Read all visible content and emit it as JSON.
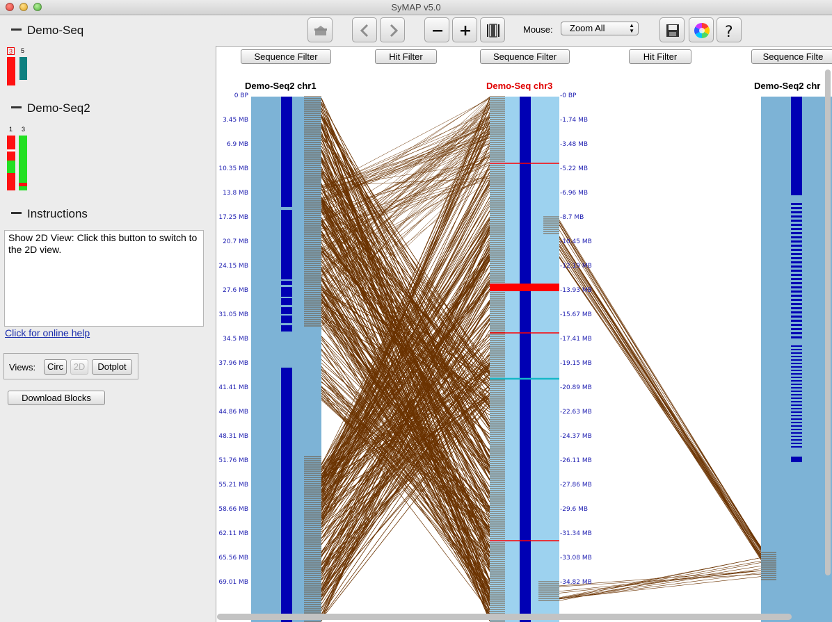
{
  "window": {
    "title": "SyMAP v5.0"
  },
  "sidebar": {
    "sections": [
      {
        "label": "Demo-Seq"
      },
      {
        "label": "Demo-Seq2"
      },
      {
        "label": "Instructions"
      }
    ],
    "demo_seq_chroms": [
      "3",
      "5"
    ],
    "demo_seq2_chroms": [
      "1",
      "3"
    ],
    "instructions_text": "Show 2D View: Click this button to switch to the 2D view.",
    "help_link": "Click for online help",
    "views_label": "Views:",
    "views_buttons": {
      "circ": "Circ",
      "twod": "2D",
      "dotplot": "Dotplot"
    },
    "download_label": "Download Blocks"
  },
  "toolbar": {
    "icons": [
      "home-icon",
      "back-arrow-icon",
      "forward-arrow-icon",
      "zoom-out-icon",
      "zoom-in-icon",
      "fit-icon",
      "save-icon",
      "color-wheel-icon",
      "help-icon"
    ],
    "mouse_label": "Mouse:",
    "mouse_mode": "Zoom All"
  },
  "canvas": {
    "filter_buttons": [
      "Sequence Filter",
      "Hit Filter",
      "Sequence Filter",
      "Hit Filter",
      "Sequence Filte"
    ],
    "tracks": [
      {
        "title": "Demo-Seq2 chr1",
        "color": "#000000"
      },
      {
        "title": "Demo-Seq chr3",
        "color": "#e00000"
      },
      {
        "title": "Demo-Seq2 chr",
        "color": "#000000"
      }
    ],
    "left_ticks": [
      "0 BP",
      "3.45 MB",
      "6.9 MB",
      "10.35 MB",
      "13.8 MB",
      "17.25 MB",
      "20.7 MB",
      "24.15 MB",
      "27.6 MB",
      "31.05 MB",
      "34.5 MB",
      "37.96 MB",
      "41.41 MB",
      "44.86 MB",
      "48.31 MB",
      "51.76 MB",
      "55.21 MB",
      "58.66 MB",
      "62.11 MB",
      "65.56 MB",
      "69.01 MB"
    ],
    "mid_ticks": [
      "0 BP",
      "1.74 MB",
      "3.48 MB",
      "5.22 MB",
      "6.96 MB",
      "8.7 MB",
      "10.45 MB",
      "12.19 MB",
      "13.93 MB",
      "15.67 MB",
      "17.41 MB",
      "19.15 MB",
      "20.89 MB",
      "22.63 MB",
      "24.37 MB",
      "26.11 MB",
      "27.86 MB",
      "29.6 MB",
      "31.34 MB",
      "33.08 MB",
      "34.82 MB"
    ]
  },
  "colors": {
    "hit_line": "#6b3300",
    "track_left": "#7db3d6",
    "track_mid": "#9dd2ef",
    "gene_band": "#0000b4",
    "highlight_red": "#ff0000",
    "highlight_cyan": "#17b8c8"
  }
}
